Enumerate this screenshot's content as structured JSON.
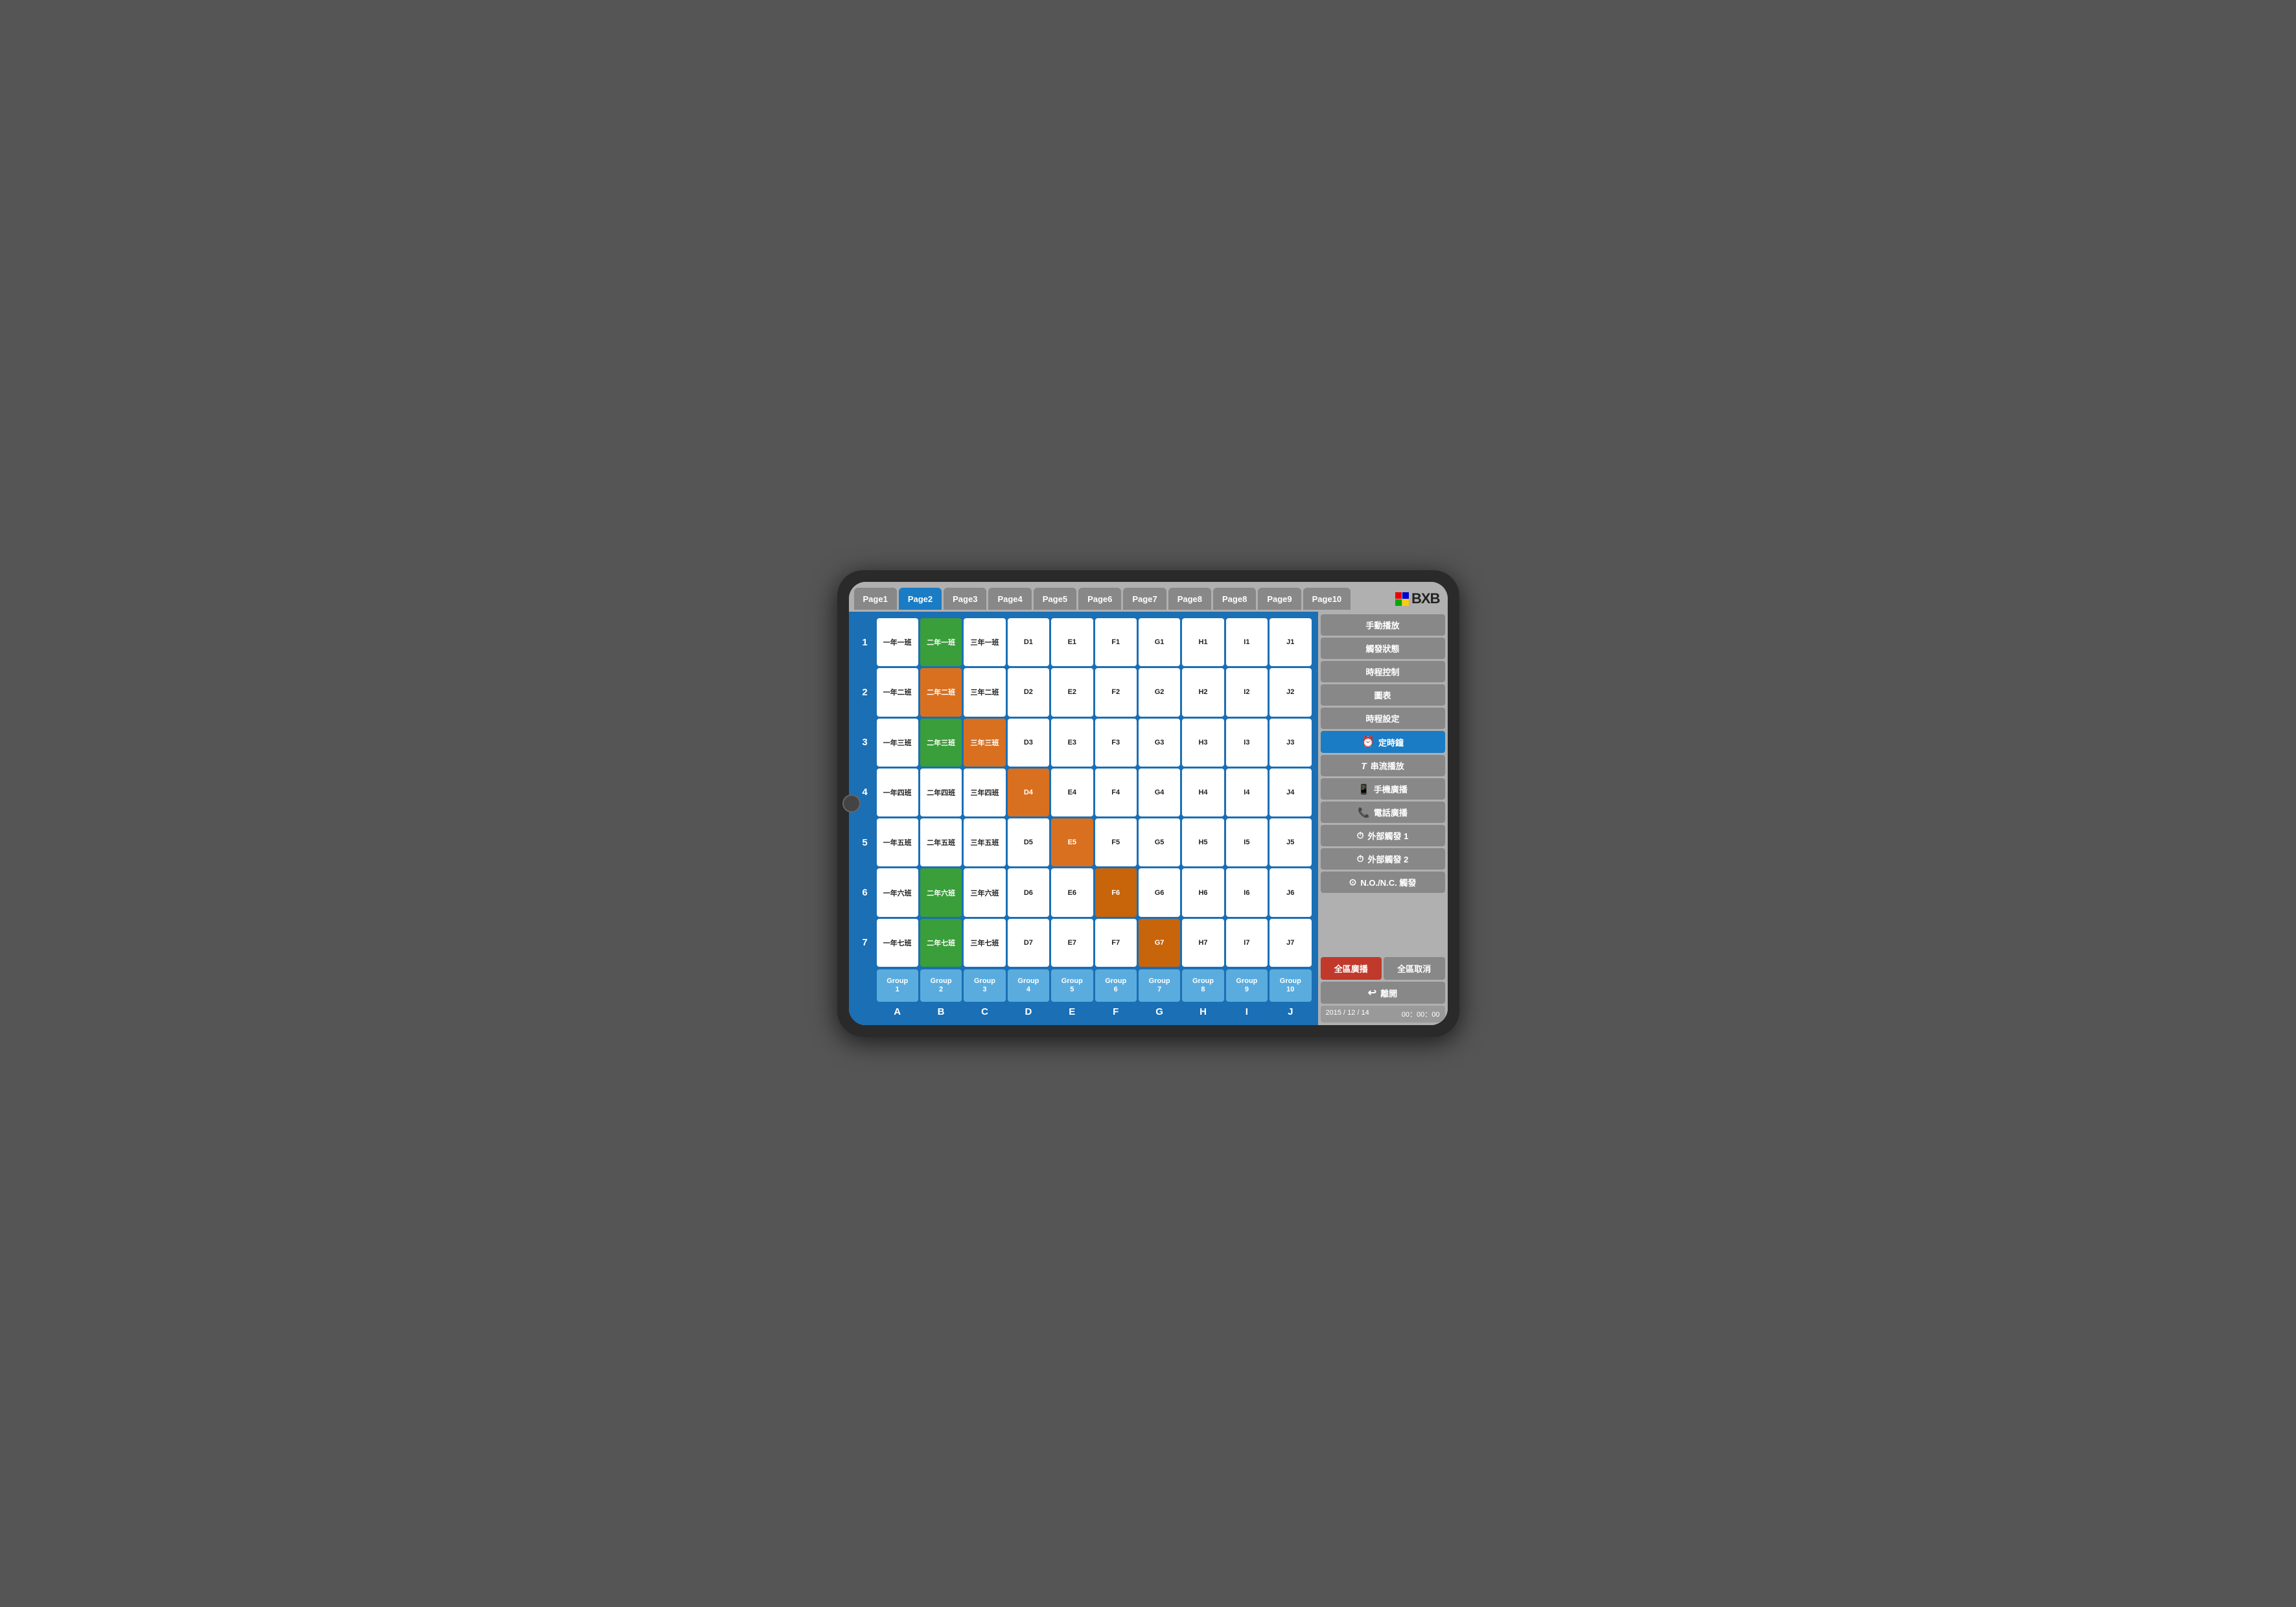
{
  "tabs": [
    {
      "label": "Page1",
      "active": false
    },
    {
      "label": "Page2",
      "active": true
    },
    {
      "label": "Page3",
      "active": false
    },
    {
      "label": "Page4",
      "active": false
    },
    {
      "label": "Page5",
      "active": false
    },
    {
      "label": "Page6",
      "active": false
    },
    {
      "label": "Page7",
      "active": false
    },
    {
      "label": "Page8",
      "active": false
    },
    {
      "label": "Page8",
      "active": false
    },
    {
      "label": "Page9",
      "active": false
    },
    {
      "label": "Page10",
      "active": false
    }
  ],
  "rows": [
    {
      "rowNum": "1",
      "cells": [
        {
          "label": "一年一班",
          "color": ""
        },
        {
          "label": "二年一班",
          "color": "green"
        },
        {
          "label": "三年一班",
          "color": ""
        },
        {
          "label": "D1",
          "color": ""
        },
        {
          "label": "E1",
          "color": ""
        },
        {
          "label": "F1",
          "color": ""
        },
        {
          "label": "G1",
          "color": ""
        },
        {
          "label": "H1",
          "color": ""
        },
        {
          "label": "I1",
          "color": ""
        },
        {
          "label": "J1",
          "color": ""
        }
      ]
    },
    {
      "rowNum": "2",
      "cells": [
        {
          "label": "一年二班",
          "color": ""
        },
        {
          "label": "二年二班",
          "color": "orange"
        },
        {
          "label": "三年二班",
          "color": ""
        },
        {
          "label": "D2",
          "color": ""
        },
        {
          "label": "E2",
          "color": ""
        },
        {
          "label": "F2",
          "color": ""
        },
        {
          "label": "G2",
          "color": ""
        },
        {
          "label": "H2",
          "color": ""
        },
        {
          "label": "I2",
          "color": ""
        },
        {
          "label": "J2",
          "color": ""
        }
      ]
    },
    {
      "rowNum": "3",
      "cells": [
        {
          "label": "一年三班",
          "color": ""
        },
        {
          "label": "二年三班",
          "color": "green"
        },
        {
          "label": "三年三班",
          "color": "orange"
        },
        {
          "label": "D3",
          "color": ""
        },
        {
          "label": "E3",
          "color": ""
        },
        {
          "label": "F3",
          "color": ""
        },
        {
          "label": "G3",
          "color": ""
        },
        {
          "label": "H3",
          "color": ""
        },
        {
          "label": "I3",
          "color": ""
        },
        {
          "label": "J3",
          "color": ""
        }
      ]
    },
    {
      "rowNum": "4",
      "cells": [
        {
          "label": "一年四班",
          "color": ""
        },
        {
          "label": "二年四班",
          "color": ""
        },
        {
          "label": "三年四班",
          "color": ""
        },
        {
          "label": "D4",
          "color": "orange"
        },
        {
          "label": "E4",
          "color": ""
        },
        {
          "label": "F4",
          "color": ""
        },
        {
          "label": "G4",
          "color": ""
        },
        {
          "label": "H4",
          "color": ""
        },
        {
          "label": "I4",
          "color": ""
        },
        {
          "label": "J4",
          "color": ""
        }
      ]
    },
    {
      "rowNum": "5",
      "cells": [
        {
          "label": "一年五班",
          "color": ""
        },
        {
          "label": "二年五班",
          "color": ""
        },
        {
          "label": "三年五班",
          "color": ""
        },
        {
          "label": "D5",
          "color": ""
        },
        {
          "label": "E5",
          "color": "orange"
        },
        {
          "label": "F5",
          "color": ""
        },
        {
          "label": "G5",
          "color": ""
        },
        {
          "label": "H5",
          "color": ""
        },
        {
          "label": "I5",
          "color": ""
        },
        {
          "label": "J5",
          "color": ""
        }
      ]
    },
    {
      "rowNum": "6",
      "cells": [
        {
          "label": "一年六班",
          "color": ""
        },
        {
          "label": "二年六班",
          "color": "green"
        },
        {
          "label": "三年六班",
          "color": ""
        },
        {
          "label": "D6",
          "color": ""
        },
        {
          "label": "E6",
          "color": ""
        },
        {
          "label": "F6",
          "color": "dark-orange"
        },
        {
          "label": "G6",
          "color": ""
        },
        {
          "label": "H6",
          "color": ""
        },
        {
          "label": "I6",
          "color": ""
        },
        {
          "label": "J6",
          "color": ""
        }
      ]
    },
    {
      "rowNum": "7",
      "cells": [
        {
          "label": "一年七班",
          "color": ""
        },
        {
          "label": "二年七班",
          "color": "green"
        },
        {
          "label": "三年七班",
          "color": ""
        },
        {
          "label": "D7",
          "color": ""
        },
        {
          "label": "E7",
          "color": ""
        },
        {
          "label": "F7",
          "color": ""
        },
        {
          "label": "G7",
          "color": "dark-orange"
        },
        {
          "label": "H7",
          "color": ""
        },
        {
          "label": "I7",
          "color": ""
        },
        {
          "label": "J7",
          "color": ""
        }
      ]
    }
  ],
  "groups": [
    {
      "label": "Group\n1"
    },
    {
      "label": "Group\n2"
    },
    {
      "label": "Group\n3"
    },
    {
      "label": "Group\n4"
    },
    {
      "label": "Group\n5"
    },
    {
      "label": "Group\n6"
    },
    {
      "label": "Group\n7"
    },
    {
      "label": "Group\n8"
    },
    {
      "label": "Group\n9"
    },
    {
      "label": "Group\n10"
    }
  ],
  "colLabels": [
    "A",
    "B",
    "C",
    "D",
    "E",
    "F",
    "G",
    "H",
    "I",
    "J"
  ],
  "sidebar": {
    "buttons": [
      {
        "label": "手動播放",
        "icon": "",
        "active": false
      },
      {
        "label": "觸發狀態",
        "icon": "",
        "active": false
      },
      {
        "label": "時程控制",
        "icon": "",
        "active": false
      },
      {
        "label": "圖表",
        "icon": "",
        "active": false
      },
      {
        "label": "時程設定",
        "icon": "",
        "active": false
      },
      {
        "label": "定時鐘",
        "icon": "⏰",
        "active": true
      },
      {
        "label": "串流播放",
        "icon": "T",
        "active": false
      },
      {
        "label": "手機廣播",
        "icon": "📱",
        "active": false
      },
      {
        "label": "電話廣播",
        "icon": "📞",
        "active": false
      },
      {
        "label": "外部觸發 1",
        "icon": "⏱",
        "active": false
      },
      {
        "label": "外部觸發 2",
        "icon": "⏱",
        "active": false
      },
      {
        "label": "N.O./N.C. 觸發",
        "icon": "⊙",
        "active": false
      }
    ],
    "broadcast_all": "全區廣播",
    "cancel_all": "全區取消",
    "exit": "離開",
    "date": "2015 / 12 / 14",
    "time": "00：00：00"
  }
}
